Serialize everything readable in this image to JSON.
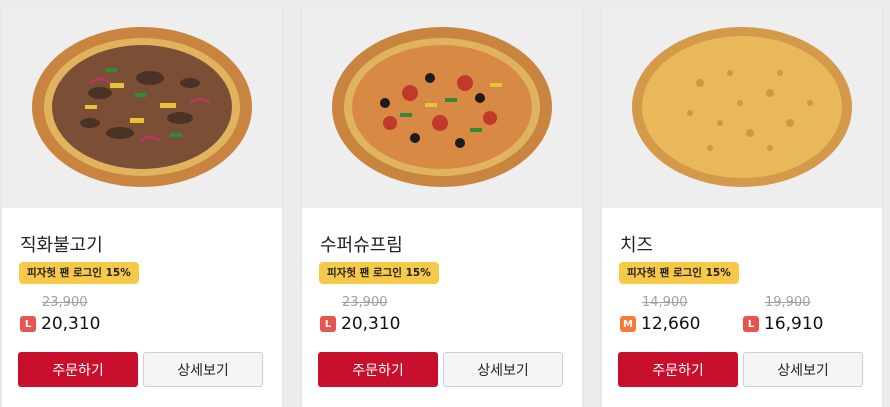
{
  "products": [
    {
      "name": "직화불고기",
      "badge": "피자헛 팬 로그인 15%",
      "prices": [
        {
          "size": "L",
          "original": "23,900",
          "sale": "20,310"
        }
      ],
      "order_label": "주문하기",
      "detail_label": "상세보기"
    },
    {
      "name": "수퍼슈프림",
      "badge": "피자헛 팬 로그인 15%",
      "prices": [
        {
          "size": "L",
          "original": "23,900",
          "sale": "20,310"
        }
      ],
      "order_label": "주문하기",
      "detail_label": "상세보기"
    },
    {
      "name": "치즈",
      "badge": "피자헛 팬 로그인 15%",
      "prices": [
        {
          "size": "M",
          "original": "14,900",
          "sale": "12,660"
        },
        {
          "size": "L",
          "original": "19,900",
          "sale": "16,910"
        }
      ],
      "order_label": "주문하기",
      "detail_label": "상세보기"
    }
  ],
  "colors": {
    "order_button": "#c8102e",
    "badge": "#f7c948",
    "size_L": "#e8554e",
    "size_M": "#f47b3a"
  }
}
